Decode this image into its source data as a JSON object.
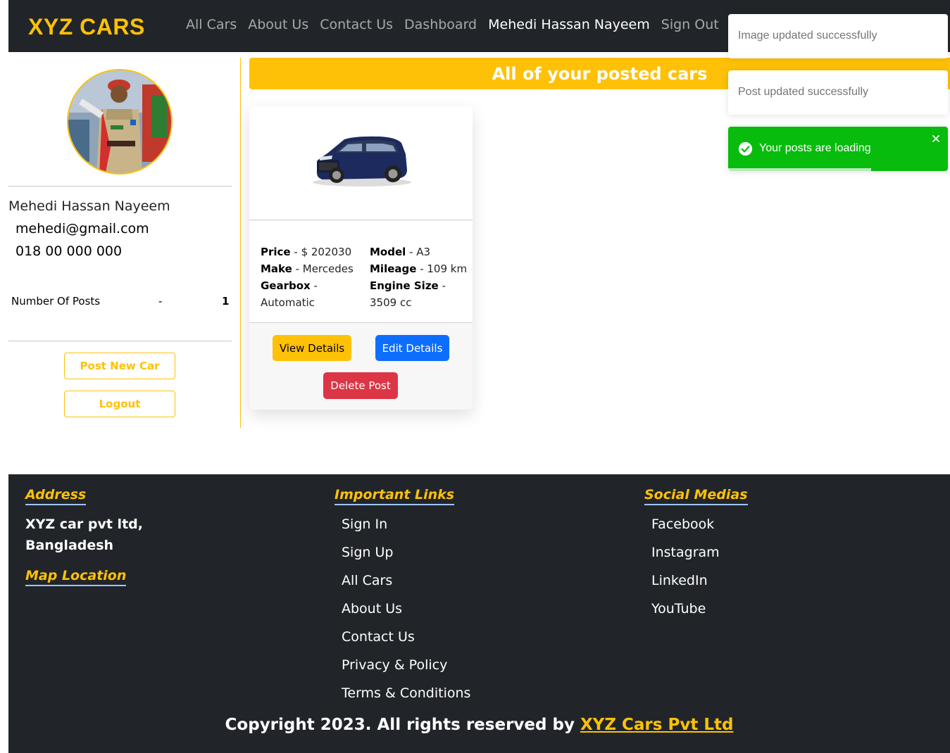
{
  "navbar": {
    "brand": "XYZ CARS",
    "links": [
      "All Cars",
      "About Us",
      "Contact Us",
      "Dashboard",
      "Mehedi Hassan Nayeem",
      "Sign Out"
    ]
  },
  "profile": {
    "name": "Mehedi Hassan Nayeem",
    "email": "mehedi@gmail.com",
    "phone": "018 00 000 000",
    "posts_label": "Number Of Posts",
    "posts_separator": "-",
    "posts_count": "1",
    "post_new_label": "Post New Car",
    "logout_label": "Logout"
  },
  "main": {
    "title": "All of your posted cars",
    "cars": [
      {
        "price_label": "Price",
        "price_value": "$ 202030",
        "model_label": "Model",
        "model_value": "A3",
        "make_label": "Make",
        "make_value": "Mercedes",
        "mileage_label": "Mileage",
        "mileage_value": "109 km",
        "gearbox_label": "Gearbox",
        "gearbox_value": "Automatic",
        "engine_label": "Engine Size",
        "engine_value": "3509 cc",
        "view_label": "View Details",
        "edit_label": "Edit Details",
        "delete_label": "Delete Post"
      }
    ]
  },
  "toasts": [
    {
      "message": "Image updated successfully",
      "type": "default"
    },
    {
      "message": "Post updated successfully",
      "type": "default"
    },
    {
      "message": "Your posts are loading",
      "type": "success",
      "progress": 0.65
    }
  ],
  "footer": {
    "address_heading": "Address",
    "address_line1": "XYZ car pvt ltd,",
    "address_line2": "Bangladesh",
    "map_heading": "Map Location",
    "links_heading": "Important Links",
    "links": [
      "Sign In",
      "Sign Up",
      "All Cars",
      "About Us",
      "Contact Us",
      "Privacy & Policy",
      "Terms & Conditions"
    ],
    "social_heading": "Social Medias",
    "socials": [
      "Facebook",
      "Instagram",
      "LinkedIn",
      "YouTube"
    ],
    "copyright_text": "Copyright 2023. All rights reserved by ",
    "copyright_brand": "XYZ Cars Pvt Ltd"
  },
  "colors": {
    "accent": "#ffc107",
    "dark": "#212529",
    "primary": "#0d6efd",
    "danger": "#dc3545",
    "success": "#07bc0c"
  }
}
